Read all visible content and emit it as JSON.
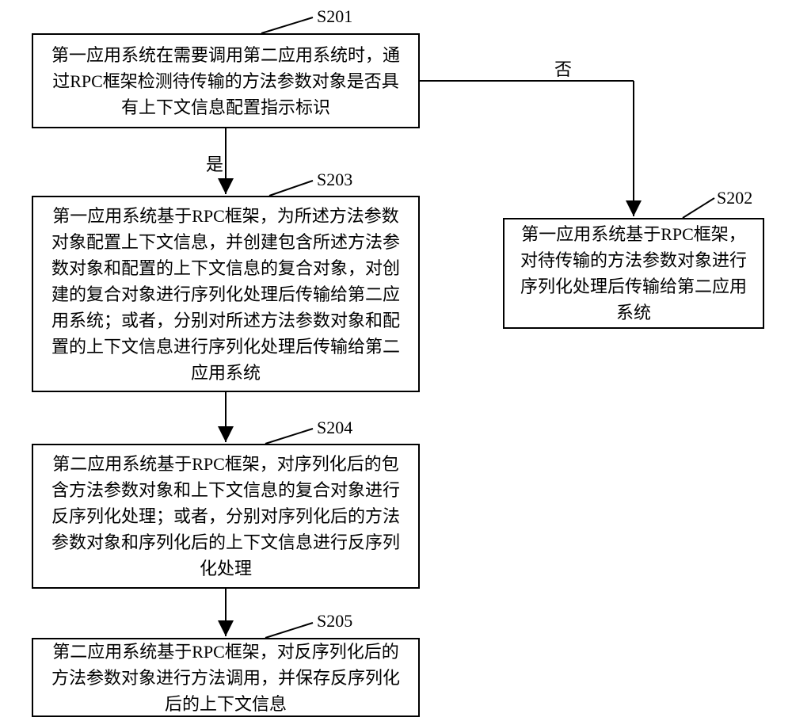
{
  "labels": {
    "s201": "S201",
    "s202": "S202",
    "s203": "S203",
    "s204": "S204",
    "s205": "S205",
    "yes": "是",
    "no": "否"
  },
  "boxes": {
    "b201": "第一应用系统在需要调用第二应用系统时，通过RPC框架检测待传输的方法参数对象是否具有上下文信息配置指示标识",
    "b202": "第一应用系统基于RPC框架，对待传输的方法参数对象进行序列化处理后传输给第二应用系统",
    "b203": "第一应用系统基于RPC框架，为所述方法参数对象配置上下文信息，并创建包含所述方法参数对象和配置的上下文信息的复合对象，对创建的复合对象进行序列化处理后传输给第二应用系统；或者，分别对所述方法参数对象和配置的上下文信息进行序列化处理后传输给第二应用系统",
    "b204": "第二应用系统基于RPC框架，对序列化后的包含方法参数对象和上下文信息的复合对象进行反序列化处理；或者，分别对序列化后的方法参数对象和序列化后的上下文信息进行反序列化处理",
    "b205": "第二应用系统基于RPC框架，对反序列化后的方法参数对象进行方法调用，并保存反序列化后的上下文信息"
  }
}
